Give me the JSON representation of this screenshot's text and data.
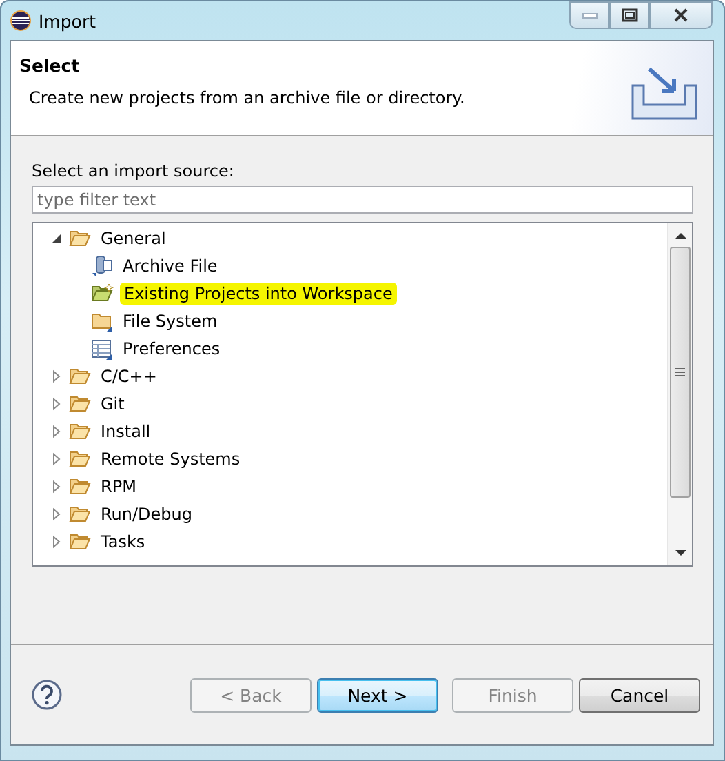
{
  "window": {
    "title": "Import"
  },
  "header": {
    "title": "Select",
    "description": "Create new projects from an archive file or directory."
  },
  "source_label": "Select an import source:",
  "filter": {
    "placeholder": "type filter text"
  },
  "tree": [
    {
      "label": "General",
      "kind": "folder",
      "expanded": true,
      "selected": false,
      "children": [
        {
          "label": "Archive File",
          "kind": "archive",
          "selected": false
        },
        {
          "label": "Existing Projects into Workspace",
          "kind": "project",
          "selected": true
        },
        {
          "label": "File System",
          "kind": "filesystem",
          "selected": false
        },
        {
          "label": "Preferences",
          "kind": "preferences",
          "selected": false
        }
      ]
    },
    {
      "label": "C/C++",
      "kind": "folder",
      "expanded": false,
      "selected": false
    },
    {
      "label": "Git",
      "kind": "folder",
      "expanded": false,
      "selected": false
    },
    {
      "label": "Install",
      "kind": "folder",
      "expanded": false,
      "selected": false
    },
    {
      "label": "Remote Systems",
      "kind": "folder",
      "expanded": false,
      "selected": false
    },
    {
      "label": "RPM",
      "kind": "folder",
      "expanded": false,
      "selected": false
    },
    {
      "label": "Run/Debug",
      "kind": "folder",
      "expanded": false,
      "selected": false
    },
    {
      "label": "Tasks",
      "kind": "folder",
      "expanded": false,
      "selected": false
    }
  ],
  "buttons": [
    {
      "label": "< Back",
      "kind": "normal",
      "disabled": true
    },
    {
      "label": "Next >",
      "kind": "default",
      "disabled": false
    },
    {
      "label": "Finish",
      "kind": "normal",
      "disabled": true
    },
    {
      "label": "Cancel",
      "kind": "normal",
      "disabled": false
    }
  ]
}
